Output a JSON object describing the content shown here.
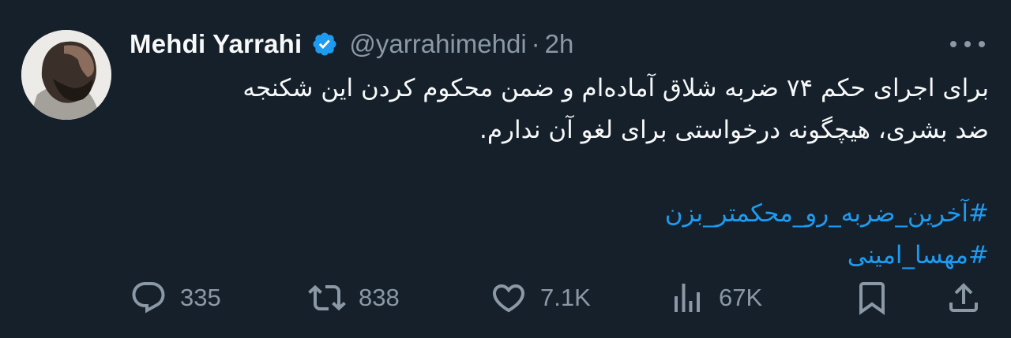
{
  "author": {
    "name": "Mehdi Yarrahi",
    "handle": "@yarrahimehdi",
    "separator": "·",
    "time": "2h",
    "verified": true,
    "verified_color": "#1d9bf0"
  },
  "tweet": {
    "line1": "برای اجرای حکم ۷۴ ضربه شلاق آماده‌ام و ضمن محکوم کردن این شکنجه",
    "line2": "ضد بشری، هیچگونه درخواستی برای لغو آن ندارم.",
    "hashtags": [
      "#آخرین_ضربه_رو_محکمتر_بزن",
      "#مهسا_امینی"
    ],
    "hashtag_color": "#1d9bf0"
  },
  "actions": {
    "replies": "335",
    "retweets": "838",
    "likes": "7.1K",
    "views": "67K"
  },
  "icons": [
    "verified-badge-icon",
    "more-options-icon",
    "reply-icon",
    "retweet-icon",
    "like-icon",
    "views-icon",
    "bookmark-icon",
    "share-icon"
  ],
  "colors": {
    "background": "#15202b",
    "text": "#f7f9f9",
    "secondary": "#8b98a5",
    "accent": "#1d9bf0"
  }
}
